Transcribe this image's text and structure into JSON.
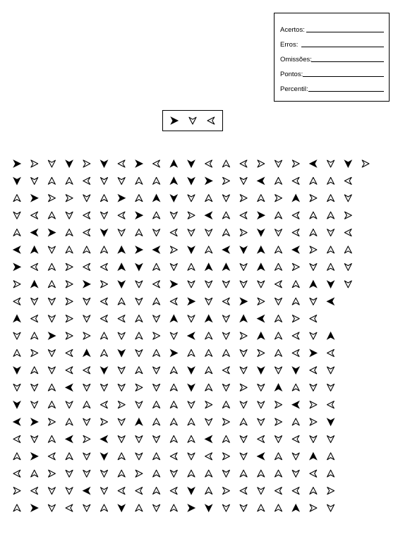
{
  "score_sheet": {
    "fields": [
      {
        "label": "Acertos:",
        "value": ""
      },
      {
        "label": "Erros:",
        "value": ""
      },
      {
        "label": "Omissões:",
        "value": ""
      },
      {
        "label": "Pontos:",
        "value": ""
      },
      {
        "label": "Percentil:",
        "value": ""
      }
    ]
  },
  "colors": {
    "ink": "#000000",
    "paper": "#ffffff"
  },
  "model": [
    {
      "dir": "right",
      "style": "solid"
    },
    {
      "dir": "down",
      "style": "outline"
    },
    {
      "dir": "left",
      "style": "outline"
    }
  ],
  "legend": {
    "dirs": {
      "R": "right",
      "L": "left",
      "U": "up",
      "D": "down"
    },
    "styles": {
      "s": "solid",
      "o": "outline"
    }
  },
  "grid_rows": [
    [
      "Rs",
      "Ro",
      "Do",
      "Ds",
      "Ro",
      "Ds",
      "Lo",
      "Rs",
      "Lo",
      "Us",
      "Ds",
      "Lo",
      "Uo",
      "Lo",
      "Ro",
      "Do",
      "Ro",
      "Ls",
      "Do",
      "Ds",
      "Ro"
    ],
    [
      "Ds",
      "Do",
      "Uo",
      "Uo",
      "Lo",
      "Do",
      "Do",
      "Uo",
      "Uo",
      "Us",
      "Ds",
      "Rs",
      "Ro",
      "Do",
      "Ls",
      "Uo",
      "Lo",
      "Uo",
      "Uo",
      "Lo"
    ],
    [
      "Uo",
      "Rs",
      "Ro",
      "Ro",
      "Do",
      "Uo",
      "Rs",
      "Uo",
      "Us",
      "Ds",
      "Do",
      "Uo",
      "Do",
      "Ro",
      "Uo",
      "Ro",
      "Us",
      "Ro",
      "Uo",
      "Do"
    ],
    [
      "Do",
      "Lo",
      "Uo",
      "Do",
      "Lo",
      "Do",
      "Lo",
      "Rs",
      "Uo",
      "Do",
      "Ro",
      "Ls",
      "Uo",
      "Lo",
      "Rs",
      "Uo",
      "Lo",
      "Uo",
      "Uo",
      "Ro"
    ],
    [
      "Uo",
      "Ls",
      "Rs",
      "Uo",
      "Lo",
      "Ds",
      "Do",
      "Uo",
      "Do",
      "Lo",
      "Do",
      "Do",
      "Uo",
      "Ro",
      "Ds",
      "Do",
      "Lo",
      "Uo",
      "Do",
      "Lo"
    ],
    [
      "Ls",
      "Us",
      "Do",
      "Uo",
      "Uo",
      "Uo",
      "Us",
      "Rs",
      "Ls",
      "Ro",
      "Ds",
      "Uo",
      "Ls",
      "Ds",
      "Us",
      "Uo",
      "Ls",
      "Ro",
      "Uo",
      "Uo"
    ],
    [
      "Rs",
      "Lo",
      "Uo",
      "Ro",
      "Lo",
      "Lo",
      "Us",
      "Ds",
      "Uo",
      "Do",
      "Uo",
      "Us",
      "Us",
      "Do",
      "Us",
      "Uo",
      "Ro",
      "Do",
      "Uo",
      "Do"
    ],
    [
      "Ro",
      "Us",
      "Uo",
      "Ro",
      "Rs",
      "Ro",
      "Ds",
      "Do",
      "Lo",
      "Rs",
      "Do",
      "Do",
      "Do",
      "Do",
      "Do",
      "Lo",
      "Uo",
      "Us",
      "Ds",
      "Do"
    ],
    [
      "Lo",
      "Do",
      "Do",
      "Ro",
      "Do",
      "Lo",
      "Uo",
      "Do",
      "Uo",
      "Lo",
      "Rs",
      "Do",
      "Lo",
      "Rs",
      "Ro",
      "Do",
      "Uo",
      "Do",
      "Ls"
    ],
    [
      "Us",
      "Lo",
      "Do",
      "Ro",
      "Do",
      "Lo",
      "Lo",
      "Uo",
      "Do",
      "Us",
      "Do",
      "Us",
      "Do",
      "Us",
      "Ls",
      "Uo",
      "Ro",
      "Lo"
    ],
    [
      "Do",
      "Uo",
      "Rs",
      "Ro",
      "Ro",
      "Uo",
      "Do",
      "Uo",
      "Ro",
      "Do",
      "Ls",
      "Uo",
      "Do",
      "Ro",
      "Us",
      "Uo",
      "Lo",
      "Do",
      "Us"
    ],
    [
      "Uo",
      "Ro",
      "Do",
      "Lo",
      "Us",
      "Uo",
      "Ds",
      "Do",
      "Uo",
      "Rs",
      "Uo",
      "Uo",
      "Uo",
      "Do",
      "Ro",
      "Uo",
      "Lo",
      "Rs",
      "Lo"
    ],
    [
      "Ds",
      "Uo",
      "Do",
      "Lo",
      "Lo",
      "Ds",
      "Do",
      "Uo",
      "Do",
      "Uo",
      "Ds",
      "Uo",
      "Lo",
      "Do",
      "Ds",
      "Do",
      "Ds",
      "Lo",
      "Do"
    ],
    [
      "Do",
      "Do",
      "Uo",
      "Ls",
      "Do",
      "Do",
      "Do",
      "Ro",
      "Do",
      "Uo",
      "Ds",
      "Uo",
      "Do",
      "Ro",
      "Do",
      "Us",
      "Uo",
      "Do",
      "Do"
    ],
    [
      "Ds",
      "Do",
      "Uo",
      "Do",
      "Uo",
      "Lo",
      "Ro",
      "Do",
      "Uo",
      "Uo",
      "Do",
      "Ro",
      "Uo",
      "Do",
      "Do",
      "Ro",
      "Ls",
      "Ro",
      "Lo"
    ],
    [
      "Ls",
      "Rs",
      "Ro",
      "Uo",
      "Do",
      "Ro",
      "Do",
      "Us",
      "Uo",
      "Uo",
      "Uo",
      "Do",
      "Ro",
      "Uo",
      "Do",
      "Ro",
      "Uo",
      "Ro",
      "Ds"
    ],
    [
      "Lo",
      "Do",
      "Uo",
      "Ls",
      "Ro",
      "Ls",
      "Do",
      "Do",
      "Do",
      "Uo",
      "Uo",
      "Ls",
      "Uo",
      "Do",
      "Lo",
      "Do",
      "Lo",
      "Do",
      "Do"
    ],
    [
      "Uo",
      "Rs",
      "Lo",
      "Uo",
      "Do",
      "Ds",
      "Uo",
      "Do",
      "Uo",
      "Lo",
      "Do",
      "Lo",
      "Ro",
      "Do",
      "Ls",
      "Uo",
      "Do",
      "Us",
      "Uo"
    ],
    [
      "Lo",
      "Uo",
      "Ro",
      "Do",
      "Do",
      "Do",
      "Uo",
      "Ro",
      "Uo",
      "Do",
      "Uo",
      "Uo",
      "Do",
      "Uo",
      "Uo",
      "Uo",
      "Do",
      "Lo",
      "Uo"
    ],
    [
      "Ro",
      "Lo",
      "Do",
      "Do",
      "Ls",
      "Do",
      "Lo",
      "Lo",
      "Uo",
      "Lo",
      "Ds",
      "Uo",
      "Ro",
      "Lo",
      "Do",
      "Lo",
      "Lo",
      "Uo",
      "Ro"
    ],
    [
      "Uo",
      "Rs",
      "Do",
      "Lo",
      "Do",
      "Uo",
      "Ds",
      "Uo",
      "Do",
      "Uo",
      "Rs",
      "Ds",
      "Do",
      "Do",
      "Uo",
      "Uo",
      "Us",
      "Ro",
      "Do"
    ]
  ]
}
